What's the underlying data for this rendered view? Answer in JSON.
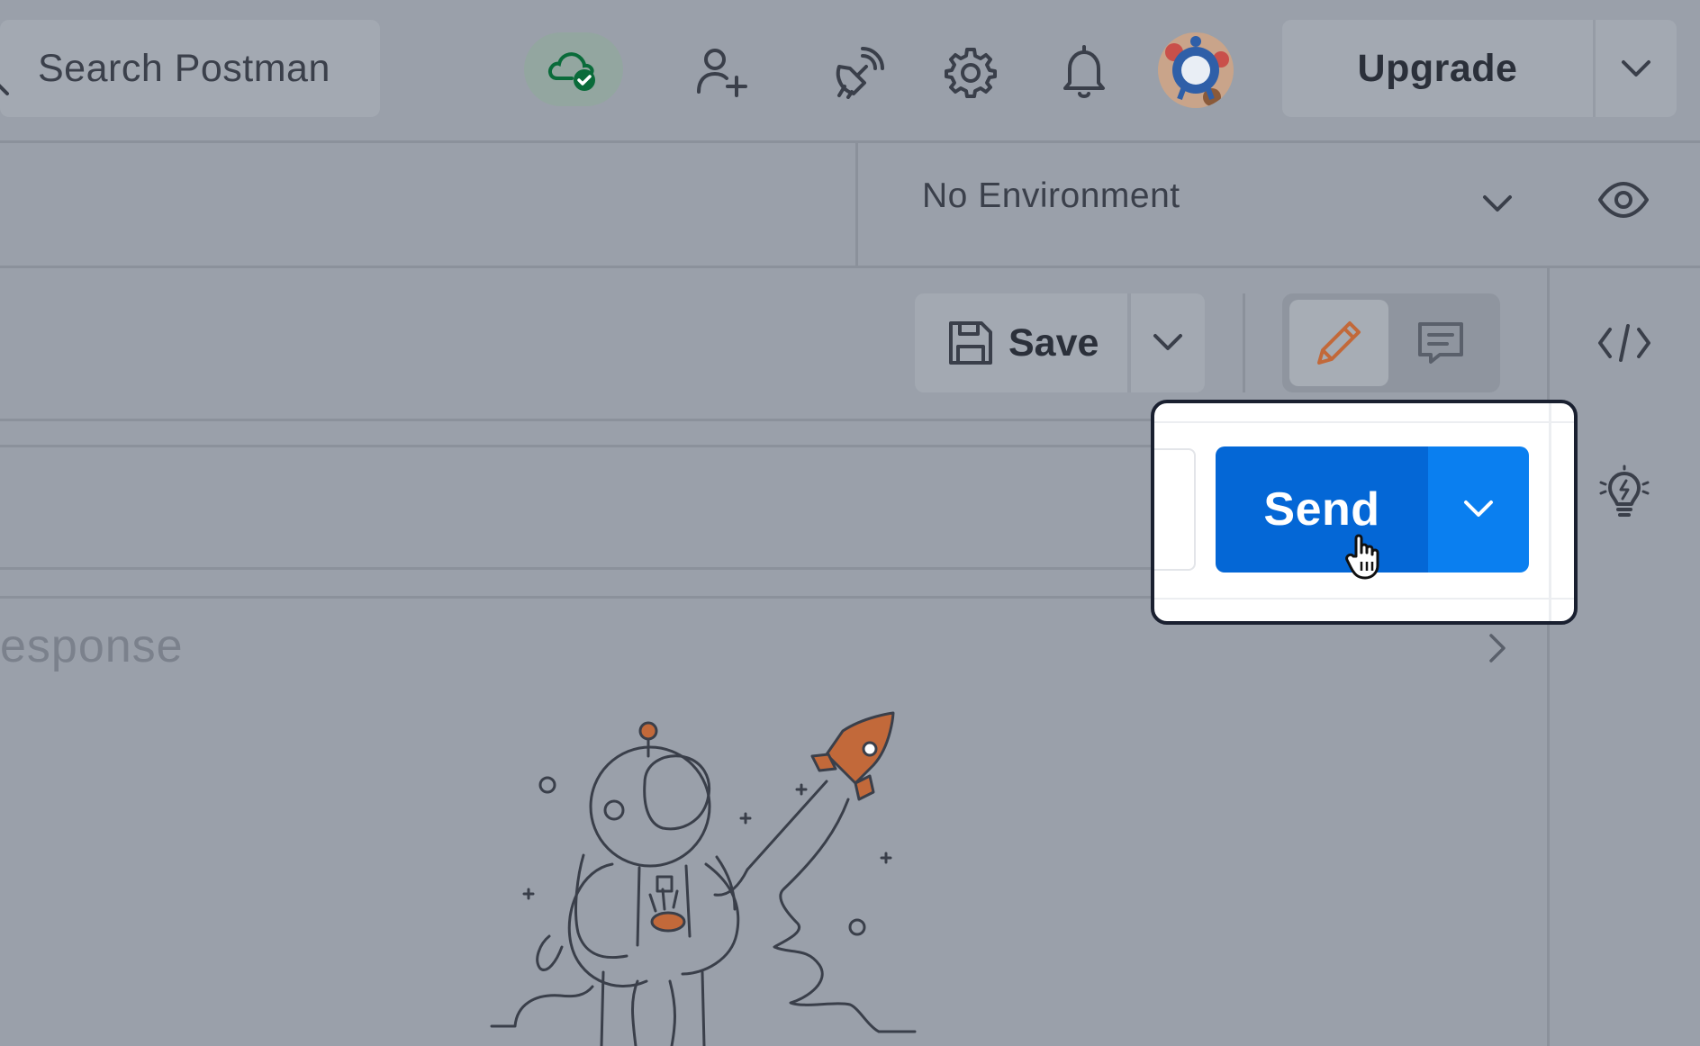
{
  "header": {
    "search_placeholder": "Search Postman",
    "upgrade_label": "Upgrade",
    "icons": [
      "search-icon",
      "cloud-sync-icon",
      "invite-user-icon",
      "satellite-icon",
      "settings-icon",
      "notifications-icon",
      "avatar",
      "chevron-down-icon"
    ]
  },
  "environment": {
    "selected": "No Environment",
    "icons": [
      "chevron-down-icon",
      "eye-icon"
    ]
  },
  "request_toolbar": {
    "save_label": "Save",
    "icons": [
      "save-icon",
      "chevron-down-icon",
      "pencil-icon",
      "comment-icon",
      "code-icon",
      "lightbulb-icon"
    ]
  },
  "send": {
    "label": "Send",
    "icons": [
      "chevron-down-icon",
      "hand-pointer-icon"
    ]
  },
  "response": {
    "title_partial": "esponse",
    "icons": [
      "chevron-right-icon",
      "astronaut-illustration"
    ]
  },
  "colors": {
    "overlay_bg": "#9aa0aa",
    "send_primary": "#0467d6",
    "send_secondary": "#0a7ff0",
    "accent_orange": "#c2693a",
    "sync_green": "#0a6b3a"
  }
}
